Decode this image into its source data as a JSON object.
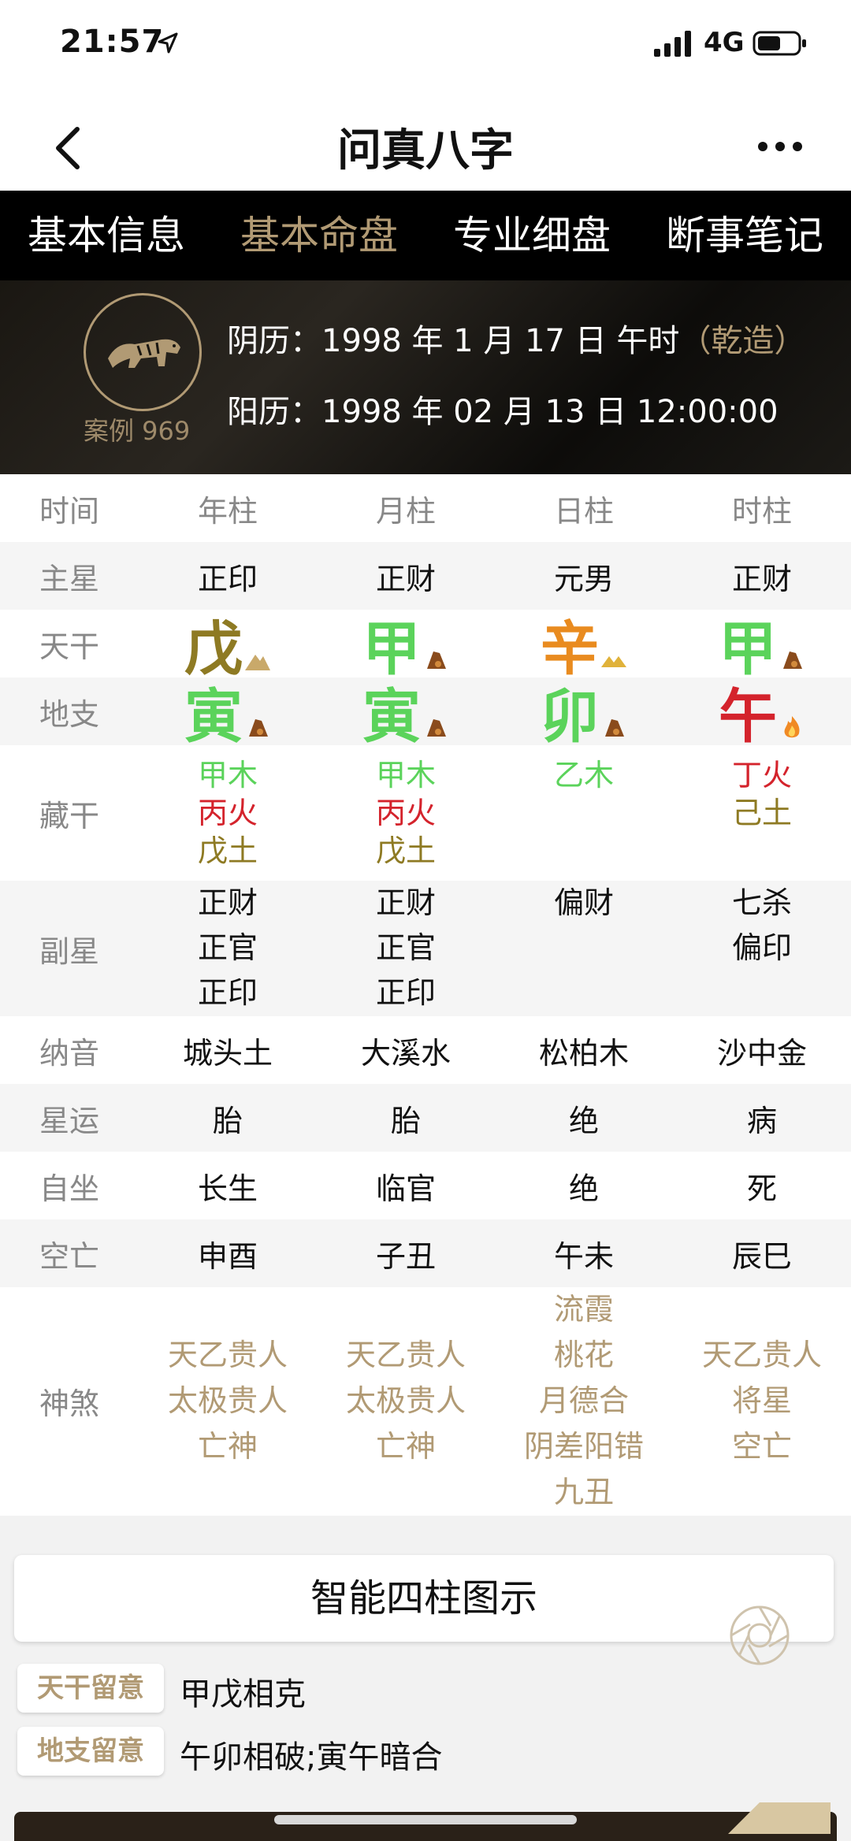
{
  "status": {
    "time": "21:57",
    "network": "4G"
  },
  "nav": {
    "title": "问真八字"
  },
  "tabs": [
    {
      "label": "基本信息",
      "active": false
    },
    {
      "label": "基本命盘",
      "active": true
    },
    {
      "label": "专业细盘",
      "active": false
    },
    {
      "label": "断事笔记",
      "active": false
    }
  ],
  "hero": {
    "case": "案例 969",
    "lunar_prefix": "阴历：",
    "lunar": "1998 年 1 月 17 日  午时",
    "sex": "（乾造）",
    "solar_prefix": "阳历：",
    "solar": "1998 年 02 月 13 日  12:00:00"
  },
  "table": {
    "header": [
      "时间",
      "年柱",
      "月柱",
      "日柱",
      "时柱"
    ],
    "main_star": {
      "label": "主星",
      "values": [
        "正印",
        "正财",
        "元男",
        "正财"
      ]
    },
    "stem": {
      "label": "天干",
      "values": [
        "戊",
        "甲",
        "辛",
        "甲"
      ]
    },
    "branch": {
      "label": "地支",
      "values": [
        "寅",
        "寅",
        "卯",
        "午"
      ]
    },
    "hidden": {
      "label": "藏干",
      "year": [
        "甲木",
        "丙火",
        "戊土"
      ],
      "month": [
        "甲木",
        "丙火",
        "戊土"
      ],
      "day": [
        "乙木"
      ],
      "hour": [
        "丁火",
        "己土"
      ]
    },
    "sub_star": {
      "label": "副星",
      "year": [
        "正财",
        "正官",
        "正印"
      ],
      "month": [
        "正财",
        "正官",
        "正印"
      ],
      "day": [
        "偏财"
      ],
      "hour": [
        "七杀",
        "偏印"
      ]
    },
    "nayin": {
      "label": "纳音",
      "values": [
        "城头土",
        "大溪水",
        "松柏木",
        "沙中金"
      ]
    },
    "xingyun": {
      "label": "星运",
      "values": [
        "胎",
        "胎",
        "绝",
        "病"
      ]
    },
    "zizuo": {
      "label": "自坐",
      "values": [
        "长生",
        "临官",
        "绝",
        "死"
      ]
    },
    "kongwang": {
      "label": "空亡",
      "values": [
        "申酉",
        "子丑",
        "午未",
        "辰巳"
      ]
    },
    "shensha": {
      "label": "神煞",
      "year": [
        "天乙贵人",
        "太极贵人",
        "亡神"
      ],
      "month": [
        "天乙贵人",
        "太极贵人",
        "亡神"
      ],
      "day": [
        "流霞",
        "桃花",
        "月德合",
        "阴差阳错",
        "九丑"
      ],
      "hour": [
        "天乙贵人",
        "将星",
        "空亡"
      ]
    }
  },
  "smart_button": "智能四柱图示",
  "notes": [
    {
      "tag": "天干留意",
      "text": "甲戊相克"
    },
    {
      "tag": "地支留意",
      "text": "午卯相破;寅午暗合"
    }
  ],
  "colors": {
    "accent": "#b19a74",
    "wood": "#5bd35b",
    "fire": "#d4232c",
    "earth": "#8e7a23",
    "metal": "#e98b1f"
  }
}
